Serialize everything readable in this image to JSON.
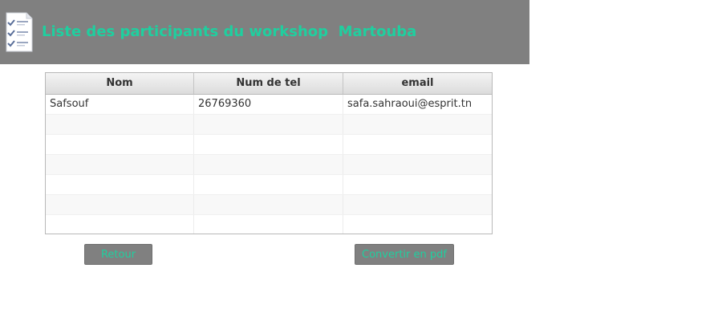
{
  "colors": {
    "accent": "#1fcf9f",
    "header_background": "#808080",
    "button_background": "#808080"
  },
  "header": {
    "icon": "checklist-document-icon",
    "title": "Liste des participants du workshop  Martouba"
  },
  "table": {
    "columns": [
      "Nom",
      "Num de tel",
      "email"
    ],
    "rows": [
      [
        "Safsouf",
        "26769360",
        "safa.sahraoui@esprit.tn"
      ],
      [
        "",
        "",
        ""
      ],
      [
        "",
        "",
        ""
      ],
      [
        "",
        "",
        ""
      ],
      [
        "",
        "",
        ""
      ],
      [
        "",
        "",
        ""
      ],
      [
        "",
        "",
        ""
      ],
      [
        "",
        "",
        ""
      ]
    ]
  },
  "buttons": {
    "retour_label": "Retour",
    "pdf_label": "Convertir en pdf"
  }
}
